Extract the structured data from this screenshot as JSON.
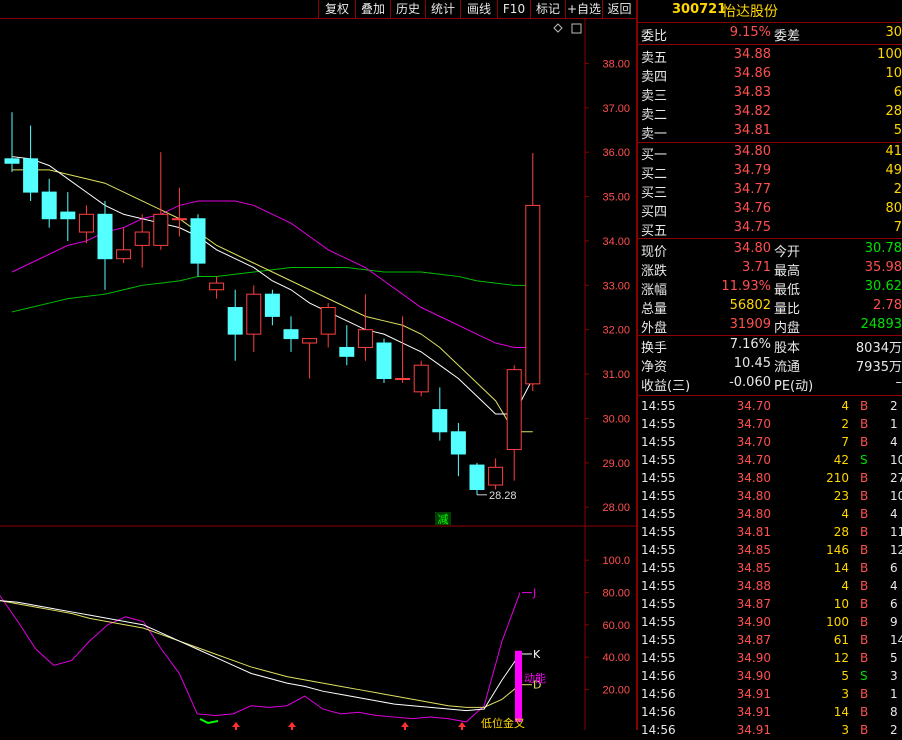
{
  "toolbar": {
    "buttons": [
      "复权",
      "叠加",
      "历史",
      "统计",
      "画线",
      "F10",
      "标记",
      "+自选",
      "返回"
    ],
    "icons": [
      "diamond-icon",
      "window-icon"
    ]
  },
  "stock": {
    "code": "300721",
    "name": "怡达股份"
  },
  "quote": {
    "weibi_label": "委比",
    "weibi_value": "9.15%",
    "weicha_label": "委差",
    "weicha_value": "30",
    "asks": [
      {
        "label": "卖五",
        "price": "34.88",
        "vol": "100"
      },
      {
        "label": "卖四",
        "price": "34.86",
        "vol": "10"
      },
      {
        "label": "卖三",
        "price": "34.83",
        "vol": "6"
      },
      {
        "label": "卖二",
        "price": "34.82",
        "vol": "28"
      },
      {
        "label": "卖一",
        "price": "34.81",
        "vol": "5"
      }
    ],
    "bids": [
      {
        "label": "买一",
        "price": "34.80",
        "vol": "41"
      },
      {
        "label": "买二",
        "price": "34.79",
        "vol": "49"
      },
      {
        "label": "买三",
        "price": "34.77",
        "vol": "2"
      },
      {
        "label": "买四",
        "price": "34.76",
        "vol": "80"
      },
      {
        "label": "买五",
        "price": "34.75",
        "vol": "7"
      }
    ],
    "stats": [
      {
        "l1": "现价",
        "v1": "34.80",
        "c1": "red",
        "l2": "今开",
        "v2": "30.78",
        "c2": "green"
      },
      {
        "l1": "涨跌",
        "v1": "3.71",
        "c1": "red",
        "l2": "最高",
        "v2": "35.98",
        "c2": "red"
      },
      {
        "l1": "涨幅",
        "v1": "11.93%",
        "c1": "red",
        "l2": "最低",
        "v2": "30.62",
        "c2": "green"
      },
      {
        "l1": "总量",
        "v1": "56802",
        "c1": "yellow",
        "l2": "量比",
        "v2": "2.78",
        "c2": "red"
      },
      {
        "l1": "外盘",
        "v1": "31909",
        "c1": "red",
        "l2": "内盘",
        "v2": "24893",
        "c2": "green"
      }
    ],
    "stats2": [
      {
        "l1": "换手",
        "v1": "7.16%",
        "l2": "股本",
        "v2": "8034万"
      },
      {
        "l1": "净资",
        "v1": "10.45",
        "l2": "流通",
        "v2": "7935万"
      },
      {
        "l1": "收益(三)",
        "v1": "-0.060",
        "l2": "PE(动)",
        "v2": "–"
      }
    ]
  },
  "ticks": [
    {
      "t": "14:55",
      "p": "34.70",
      "v": "4",
      "s": "B",
      "n": "2"
    },
    {
      "t": "14:55",
      "p": "34.70",
      "v": "2",
      "s": "B",
      "n": "1"
    },
    {
      "t": "14:55",
      "p": "34.70",
      "v": "7",
      "s": "B",
      "n": "4"
    },
    {
      "t": "14:55",
      "p": "34.70",
      "v": "42",
      "s": "S",
      "n": "10"
    },
    {
      "t": "14:55",
      "p": "34.80",
      "v": "210",
      "s": "B",
      "n": "27"
    },
    {
      "t": "14:55",
      "p": "34.80",
      "v": "23",
      "s": "B",
      "n": "10"
    },
    {
      "t": "14:55",
      "p": "34.80",
      "v": "4",
      "s": "B",
      "n": "4"
    },
    {
      "t": "14:55",
      "p": "34.81",
      "v": "28",
      "s": "B",
      "n": "11"
    },
    {
      "t": "14:55",
      "p": "34.85",
      "v": "146",
      "s": "B",
      "n": "12"
    },
    {
      "t": "14:55",
      "p": "34.85",
      "v": "14",
      "s": "B",
      "n": "6"
    },
    {
      "t": "14:55",
      "p": "34.88",
      "v": "4",
      "s": "B",
      "n": "4"
    },
    {
      "t": "14:55",
      "p": "34.87",
      "v": "10",
      "s": "B",
      "n": "6"
    },
    {
      "t": "14:55",
      "p": "34.90",
      "v": "100",
      "s": "B",
      "n": "9"
    },
    {
      "t": "14:55",
      "p": "34.87",
      "v": "61",
      "s": "B",
      "n": "14"
    },
    {
      "t": "14:55",
      "p": "34.90",
      "v": "12",
      "s": "B",
      "n": "5"
    },
    {
      "t": "14:56",
      "p": "34.90",
      "v": "5",
      "s": "S",
      "n": "3"
    },
    {
      "t": "14:56",
      "p": "34.91",
      "v": "3",
      "s": "B",
      "n": "1"
    },
    {
      "t": "14:56",
      "p": "34.91",
      "v": "14",
      "s": "B",
      "n": "8"
    },
    {
      "t": "14:56",
      "p": "34.91",
      "v": "3",
      "s": "B",
      "n": "2"
    }
  ],
  "chart_data": [
    {
      "type": "candlestick",
      "ylim": [
        27.6,
        39.0
      ],
      "yticks": [
        "38.00",
        "37.00",
        "36.00",
        "35.00",
        "34.00",
        "33.00",
        "32.00",
        "31.00",
        "30.00",
        "29.00",
        "28.00"
      ],
      "candles": [
        [
          35.85,
          35.75,
          36.9,
          35.55
        ],
        [
          35.85,
          35.1,
          36.6,
          34.9
        ],
        [
          35.1,
          34.5,
          35.4,
          34.3
        ],
        [
          34.65,
          34.5,
          35.1,
          34.0
        ],
        [
          34.2,
          34.6,
          34.8,
          33.95
        ],
        [
          34.6,
          33.6,
          34.9,
          32.9
        ],
        [
          33.6,
          33.8,
          34.3,
          33.5
        ],
        [
          33.9,
          34.2,
          34.6,
          33.4
        ],
        [
          33.9,
          34.6,
          36.0,
          33.8
        ],
        [
          34.5,
          34.5,
          35.2,
          34.1
        ],
        [
          34.5,
          33.5,
          34.6,
          33.2
        ],
        [
          32.9,
          33.05,
          33.2,
          32.7
        ],
        [
          32.5,
          31.9,
          32.9,
          31.3
        ],
        [
          31.9,
          32.8,
          33.0,
          31.5
        ],
        [
          32.8,
          32.3,
          32.9,
          32.1
        ],
        [
          32.0,
          31.8,
          32.3,
          31.5
        ],
        [
          31.7,
          31.8,
          31.8,
          30.9
        ],
        [
          31.9,
          32.5,
          32.6,
          31.6
        ],
        [
          31.6,
          31.4,
          32.1,
          31.2
        ],
        [
          31.6,
          32.0,
          32.8,
          31.3
        ],
        [
          31.7,
          30.9,
          31.8,
          30.8
        ],
        [
          30.9,
          30.9,
          32.3,
          30.8
        ],
        [
          30.6,
          31.2,
          31.3,
          30.5
        ],
        [
          30.2,
          29.7,
          30.7,
          29.5
        ],
        [
          29.7,
          29.2,
          29.9,
          28.7
        ],
        [
          28.95,
          28.4,
          29.0,
          28.28
        ],
        [
          28.5,
          28.9,
          29.1,
          28.4
        ],
        [
          29.3,
          31.1,
          31.2,
          28.6
        ],
        [
          30.78,
          34.8,
          35.98,
          30.62
        ]
      ],
      "ma_short": [
        35.9,
        35.85,
        35.7,
        35.4,
        35.1,
        34.8,
        34.6,
        34.5,
        34.4,
        34.3,
        34.1,
        33.8,
        33.6,
        33.4,
        33.1,
        32.9,
        32.6,
        32.4,
        32.2,
        32.0,
        31.9,
        31.7,
        31.5,
        31.2,
        30.9,
        30.5,
        30.1,
        30.1,
        30.9
      ],
      "ma_mid": [
        35.6,
        35.6,
        35.6,
        35.5,
        35.4,
        35.3,
        35.1,
        34.9,
        34.7,
        34.5,
        34.2,
        33.9,
        33.7,
        33.5,
        33.3,
        33.1,
        32.9,
        32.7,
        32.5,
        32.3,
        32.2,
        32.1,
        31.9,
        31.6,
        31.2,
        30.8,
        30.4,
        29.7,
        29.7
      ],
      "ma_long1": [
        33.3,
        33.5,
        33.7,
        33.9,
        34.0,
        34.2,
        34.3,
        34.5,
        34.6,
        34.8,
        34.9,
        34.9,
        34.9,
        34.8,
        34.6,
        34.4,
        34.1,
        33.8,
        33.6,
        33.4,
        33.1,
        32.8,
        32.5,
        32.3,
        32.1,
        31.9,
        31.7,
        31.6,
        31.6
      ],
      "ma_long2": [
        32.4,
        32.5,
        32.6,
        32.7,
        32.75,
        32.8,
        32.9,
        33.0,
        33.05,
        33.1,
        33.2,
        33.2,
        33.25,
        33.3,
        33.35,
        33.4,
        33.4,
        33.4,
        33.4,
        33.35,
        33.3,
        33.3,
        33.3,
        33.25,
        33.2,
        33.1,
        33.05,
        33.0,
        33.0
      ],
      "low_label": "28.28",
      "marker_label": "减"
    },
    {
      "type": "line",
      "ylim": [
        -5,
        110
      ],
      "yticks": [
        "100.0",
        "80.00",
        "60.00",
        "40.00",
        "20.00"
      ],
      "K": [
        75,
        74,
        72,
        70,
        68,
        66,
        64,
        62,
        60,
        55,
        50,
        45,
        40,
        35,
        30,
        27,
        24,
        22,
        19,
        17,
        15,
        13,
        11,
        10,
        9,
        8,
        7,
        8,
        26,
        42
      ],
      "D": [
        75,
        73,
        71,
        69,
        67,
        64,
        62,
        60,
        58,
        54,
        50,
        46,
        42,
        38,
        34,
        31,
        28,
        26,
        24,
        22,
        20,
        18,
        16,
        14,
        12,
        10,
        9,
        9,
        14,
        23
      ],
      "J": [
        78,
        62,
        45,
        35,
        38,
        50,
        60,
        65,
        62,
        45,
        30,
        5,
        4,
        5,
        10,
        9,
        10,
        16,
        8,
        5,
        6,
        4,
        3,
        2,
        3,
        2,
        0,
        10,
        50,
        80
      ],
      "labels": {
        "j": "J",
        "k": "K",
        "d": "D",
        "kuneng": "动能",
        "cross": "低位金叉"
      }
    }
  ]
}
